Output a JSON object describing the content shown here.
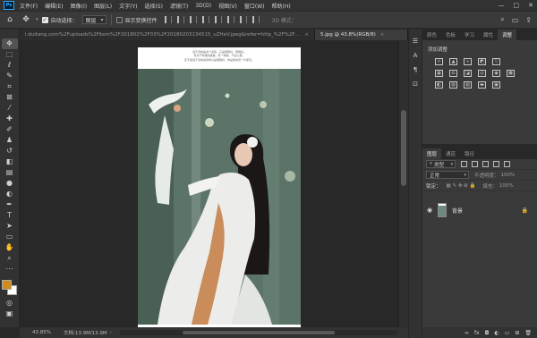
{
  "app": {
    "logo_text": "Ps"
  },
  "menu": [
    "文件(F)",
    "编辑(E)",
    "图像(I)",
    "图层(L)",
    "文字(Y)",
    "选择(S)",
    "滤镜(T)",
    "3D(D)",
    "视图(V)",
    "窗口(W)",
    "帮助(H)"
  ],
  "options": {
    "auto_select_label": "自动选择：",
    "auto_select_value": "图层",
    "show_transform_label": "显示变换控件",
    "mode_3d_label": "3D 模式："
  },
  "tabs": [
    {
      "label": "i.duitang.com%2Fuploads%2Fitem%2F201802%2F03%2F20180203134515_uZHeV.jpeg&refer=http_%2F%2Fb-ssl.duitang.jpg",
      "active": false
    },
    {
      "label": "5.jpg @ 43.8%(RGB/8)",
      "active": true
    }
  ],
  "document": {
    "header_lines": [
      "说不清的是这个爱情，只是刚刚好，刚刚好。",
      "有关于你我的故事。有一种美，不在心里。",
      "还不如说不清的喜欢你只是刚刚好，你是我的另一片夏天。"
    ]
  },
  "status": {
    "zoom": "43.85%",
    "doc_size": "文档:13.9M/13.9M"
  },
  "right_tabs_top": [
    {
      "label": "颜色",
      "active": false
    },
    {
      "label": "色板",
      "active": false
    },
    {
      "label": "学习",
      "active": false
    },
    {
      "label": "属性",
      "active": false
    },
    {
      "label": "调整",
      "active": true
    }
  ],
  "adjustments": {
    "title": "添加调整"
  },
  "layers_tabs": [
    {
      "label": "图层",
      "active": true
    },
    {
      "label": "通道",
      "active": false
    },
    {
      "label": "路径",
      "active": false
    }
  ],
  "layers": {
    "kind_filter": "类型",
    "blend_mode": "正常",
    "opacity_label": "不透明度：",
    "opacity_value": "100%",
    "lock_label": "锁定：",
    "fill_label": "填充：",
    "fill_value": "100%",
    "items": [
      {
        "name": "背景",
        "visible": true,
        "locked": true
      }
    ]
  },
  "colors": {
    "foreground": "#d08b1e",
    "background": "#ffffff",
    "accent": "#31a8ff"
  }
}
